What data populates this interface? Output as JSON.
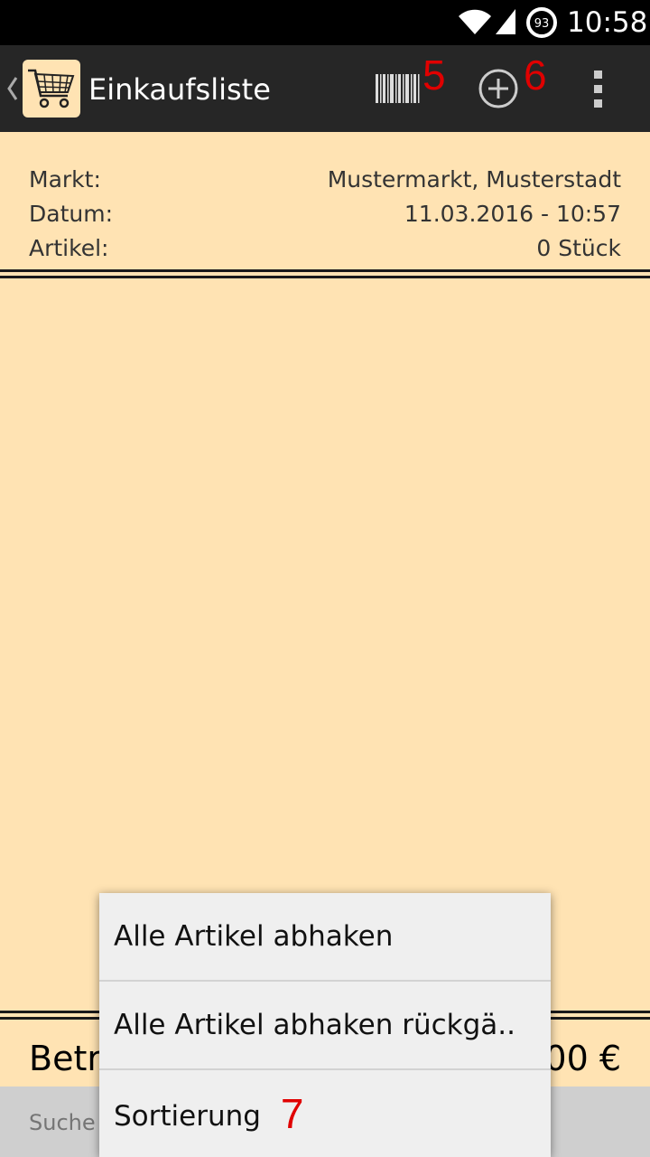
{
  "status_bar": {
    "time": "10:58",
    "battery_level": "93",
    "icons": [
      "wifi-icon",
      "cell-signal-icon",
      "battery-icon"
    ]
  },
  "action_bar": {
    "title": "Einkaufsliste",
    "icons": [
      "back-chevron-icon",
      "shopping-cart-icon",
      "barcode-icon",
      "add-circle-icon",
      "overflow-menu-icon"
    ],
    "annotations": {
      "barcode": "5",
      "add": "6"
    }
  },
  "info": {
    "market_label": "Markt:",
    "market_value": "Mustermarkt, Musterstadt",
    "date_label": "Datum:",
    "date_value": "11.03.2016 - 10:57",
    "items_label": "Artikel:",
    "items_value": "0 Stück"
  },
  "bottom": {
    "sum_label_visible": "Betr",
    "sum_value_visible": "00 €",
    "search_placeholder": "Suche"
  },
  "menu": {
    "items": [
      {
        "label": "Alle Artikel abhaken"
      },
      {
        "label": "Alle Artikel abhaken rückgä.."
      },
      {
        "label": "Sortierung",
        "annotation": "7"
      }
    ]
  },
  "colors": {
    "background": "#ffe3b3",
    "action_bar": "#262626",
    "status_bar": "#000000",
    "menu_background": "#efefef",
    "annotation": "#e00000"
  }
}
